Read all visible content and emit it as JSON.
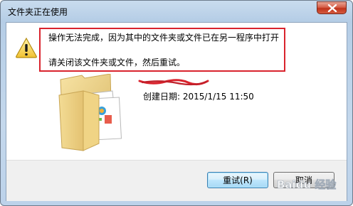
{
  "window": {
    "title": "文件夹正在使用"
  },
  "message": {
    "line1": "操作无法完成，因为其中的文件夹或文件已在另一程序中打开",
    "line2": "请关闭该文件夹或文件，然后重试。"
  },
  "item": {
    "date_label": "创建日期: 2015/1/15 11:50"
  },
  "buttons": {
    "retry_label": "重试(R)",
    "cancel_label": "取消"
  },
  "watermark": {
    "text": "Baidu 经验"
  },
  "colors": {
    "highlight": "#d9232d",
    "close_button": "#c0331c",
    "default_button_border": "#3c7fb1"
  },
  "icons": {
    "warning": "warning-icon",
    "folder": "folder-icon",
    "close": "close-icon"
  }
}
